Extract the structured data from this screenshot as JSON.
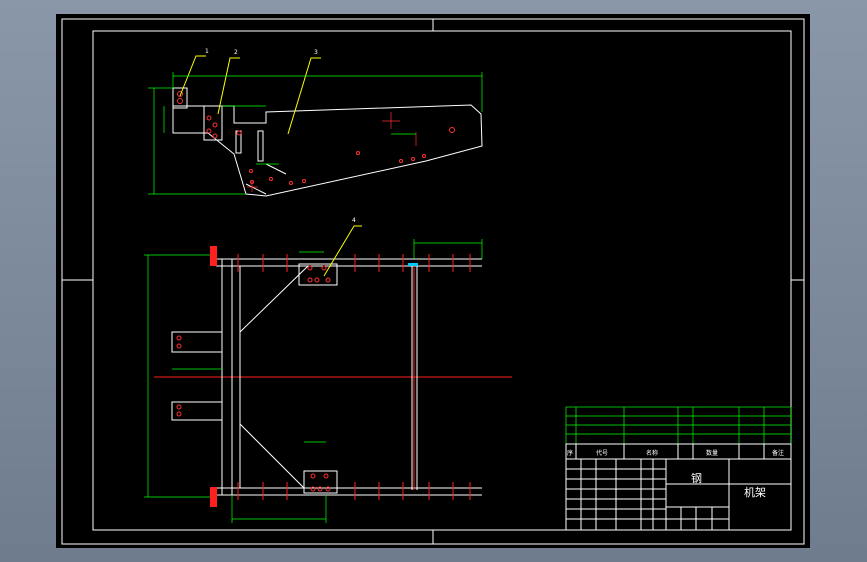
{
  "title_block": {
    "material": "钢",
    "drawing_name": "机架",
    "bom_header": {
      "seq": "序",
      "code": "代号",
      "name": "名称",
      "qty": "数量",
      "note": "备注"
    }
  },
  "colors": {
    "background": "#000000",
    "outline": "#ffffff",
    "dimension": "#00ff00",
    "centerline": "#ff0000",
    "hole": "#ff3030",
    "leader": "#ffff00",
    "clamp": "#ff2020"
  }
}
